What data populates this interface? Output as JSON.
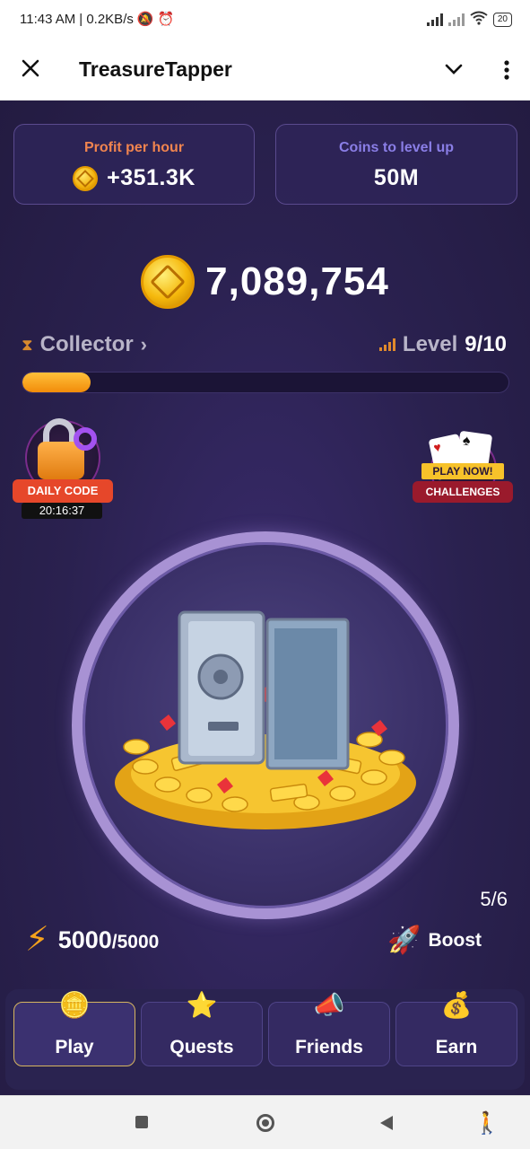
{
  "status_bar": {
    "time": "11:43 AM",
    "speed": "| 0.2KB/s",
    "battery": "20"
  },
  "app": {
    "title": "TreasureTapper"
  },
  "stats": {
    "profit_label": "Profit per hour",
    "profit_value": "+351.3K",
    "levelup_label": "Coins to level up",
    "levelup_value": "50M"
  },
  "balance": "7,089,754",
  "rank": {
    "name": "Collector",
    "level_word": "Level",
    "level_value": "9/10",
    "progress": 0.14
  },
  "daily_code": {
    "label": "DAILY CODE",
    "timer": "20:16:37"
  },
  "challenges": {
    "badge": "PLAY NOW!",
    "label": "CHALLENGES"
  },
  "boost": {
    "count": "5/6",
    "label": "Boost"
  },
  "energy": {
    "current": "5000",
    "max": "/5000"
  },
  "nav": {
    "tabs": [
      {
        "label": "Play",
        "icon": "coins-icon",
        "active": true
      },
      {
        "label": "Quests",
        "icon": "star-icon",
        "active": false
      },
      {
        "label": "Friends",
        "icon": "megaphone-icon",
        "active": false
      },
      {
        "label": "Earn",
        "icon": "money-bag-icon",
        "active": false
      }
    ]
  },
  "colors": {
    "background": "#2a214f",
    "accent_orange": "#f28c0a",
    "profit_label": "#f0844f",
    "levelup_label": "#8a7ee6",
    "active_tab_border": "#d6b55f"
  }
}
